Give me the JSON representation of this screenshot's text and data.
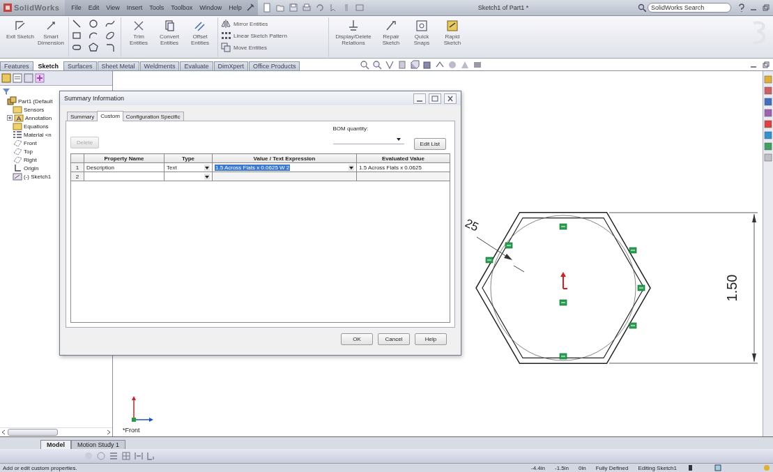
{
  "title_bar": {
    "logo": "SolidWorks",
    "menu": [
      "File",
      "Edit",
      "View",
      "Insert",
      "Tools",
      "Toolbox",
      "Window",
      "Help"
    ],
    "document_title": "Sketch1 of Part1 *",
    "search": {
      "placeholder": "SolidWorks Search"
    }
  },
  "ribbon": {
    "large_tools": [
      "Exit Sketch",
      "Smart Dimension"
    ],
    "edit_tools": [
      "Trim Entities",
      "Convert Entities",
      "Offset Entities"
    ],
    "small_tools": [
      "Mirror Entities",
      "Linear Sketch Pattern",
      "Move Entities"
    ],
    "relation_tools": [
      "Display/Delete Relations",
      "Repair Sketch",
      "Quick Snaps",
      "Rapid Sketch"
    ]
  },
  "command_tabs": [
    {
      "label": "Features",
      "selected": false
    },
    {
      "label": "Sketch",
      "selected": true
    },
    {
      "label": "Surfaces",
      "selected": false
    },
    {
      "label": "Sheet Metal",
      "selected": false
    },
    {
      "label": "Weldments",
      "selected": false
    },
    {
      "label": "Evaluate",
      "selected": false
    },
    {
      "label": "DimXpert",
      "selected": false
    },
    {
      "label": "Office Products",
      "selected": false
    }
  ],
  "feature_tree": {
    "root": {
      "label": "Part1 (Default",
      "kind": "part",
      "children": [
        {
          "label": "Sensors",
          "kind": "folder"
        },
        {
          "label": "Annotation",
          "kind": "annotation",
          "expandable": true
        },
        {
          "label": "Equations",
          "kind": "folder"
        },
        {
          "label": "Material <n",
          "kind": "material"
        },
        {
          "label": "Front",
          "kind": "plane"
        },
        {
          "label": "Top",
          "kind": "plane"
        },
        {
          "label": "Right",
          "kind": "plane"
        },
        {
          "label": "Origin",
          "kind": "origin"
        },
        {
          "label": "(-) Sketch1",
          "kind": "sketch"
        }
      ]
    }
  },
  "canvas": {
    "dimension": "1.50",
    "partial_dimension": "25",
    "view_label": "*Front"
  },
  "dialog": {
    "title": "Summary Information",
    "tabs": [
      {
        "label": "Summary",
        "selected": false
      },
      {
        "label": "Custom",
        "selected": true
      },
      {
        "label": "Configuration Specific",
        "selected": false
      }
    ],
    "delete_button": {
      "label": "Delete",
      "disabled": true
    },
    "bom_quantity_label": "BOM quantity:",
    "edit_list_button": "Edit List",
    "table": {
      "columns": [
        "Property Name",
        "Type",
        "Value / Text Expression",
        "Evaluated Value"
      ],
      "rows": [
        {
          "number": "1",
          "property_name": "Description",
          "type": "Text",
          "value": "1.5 Across Flats x 0.0625 W 2",
          "value_highlighted": true,
          "evaluated_value": "1.5 Across Flats x 0.0625"
        },
        {
          "number": "2"
        }
      ]
    },
    "buttons": [
      "OK",
      "Cancel",
      "Help"
    ]
  },
  "bottom_tabs": [
    {
      "label": "Model",
      "selected": true
    },
    {
      "label": "Motion Study 1",
      "selected": false
    }
  ],
  "status_bar": {
    "message": "Add or edit custom properties.",
    "fields": [
      "-4.4in",
      "-1.5in",
      "0in",
      "Fully Defined",
      "Editing Sketch1"
    ]
  }
}
